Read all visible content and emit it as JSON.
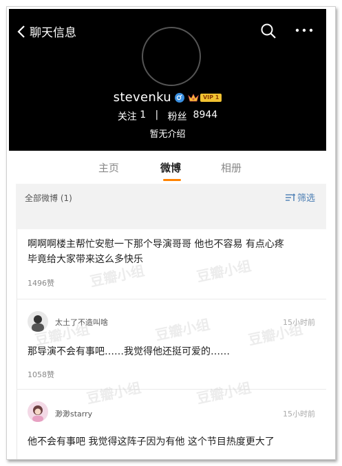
{
  "header": {
    "back_label": "聊天信息",
    "username": "stevenku",
    "vip_label": "VIP 1",
    "following_label": "关注",
    "following_count": "1",
    "separator": "|",
    "followers_label": "粉丝",
    "followers_count": "8944",
    "bio": "暂无介绍"
  },
  "tabs": [
    {
      "label": "主页"
    },
    {
      "label": "微博"
    },
    {
      "label": "相册"
    }
  ],
  "filter_bar": {
    "all_posts": "全部微博 (1)",
    "filter_label": "筛选"
  },
  "post": {
    "text_line1": "啊啊啊楼主帮忙安慰一下那个导演哥哥 他也不容易 有点心疼",
    "text_line2": "毕竟给大家带来这么多快乐",
    "likes": "1496赞"
  },
  "comments": [
    {
      "name": "太土了不造叫啥",
      "time": "15小时前",
      "text": "那导演不会有事吧……我觉得他还挺可爱的……",
      "likes": "1058赞"
    },
    {
      "name": "渺渺starry",
      "time": "15小时前",
      "text": "他不会有事吧 我觉得这阵子因为有他 这个节目热度更大了"
    }
  ],
  "watermark_text": "豆瓣小组",
  "colors": {
    "accent": "#ff8200",
    "link": "#4a7db3",
    "header_bg": "#000000"
  }
}
